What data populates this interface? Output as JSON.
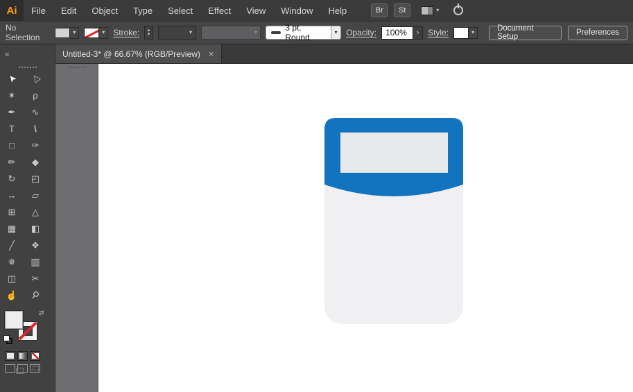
{
  "app": {
    "logo": "Ai"
  },
  "menubar": {
    "items": [
      "File",
      "Edit",
      "Object",
      "Type",
      "Select",
      "Effect",
      "View",
      "Window",
      "Help"
    ],
    "bridge_button": "Br",
    "stock_button": "St"
  },
  "controlbar": {
    "selection_status": "No Selection",
    "stroke_label": "Stroke:",
    "brush_name": "3 pt. Round",
    "opacity_label": "Opacity:",
    "opacity_value": "100%",
    "style_label": "Style:",
    "document_setup_button": "Document Setup",
    "preferences_button": "Preferences"
  },
  "tabbar": {
    "title": "Untitled-3* @ 66.67% (RGB/Preview)",
    "close": "×"
  },
  "toolbar": {
    "collapse": "«",
    "tools": [
      {
        "name": "selection",
        "glyph": "➤",
        "active": true
      },
      {
        "name": "direct-selection",
        "glyph": "▷"
      },
      {
        "name": "magic-wand",
        "glyph": "✶"
      },
      {
        "name": "lasso",
        "glyph": "ρ"
      },
      {
        "name": "pen",
        "glyph": "✒"
      },
      {
        "name": "curvature",
        "glyph": "∿"
      },
      {
        "name": "type",
        "glyph": "T"
      },
      {
        "name": "line",
        "glyph": "\\"
      },
      {
        "name": "rectangle",
        "glyph": "□"
      },
      {
        "name": "paintbrush",
        "glyph": "✑"
      },
      {
        "name": "pencil",
        "glyph": "✏"
      },
      {
        "name": "eraser",
        "glyph": "◆"
      },
      {
        "name": "rotate",
        "glyph": "↻"
      },
      {
        "name": "scale",
        "glyph": "◰"
      },
      {
        "name": "width",
        "glyph": "↔"
      },
      {
        "name": "free-transform",
        "glyph": "▱"
      },
      {
        "name": "shape-builder",
        "glyph": "⊞"
      },
      {
        "name": "perspective-grid",
        "glyph": "△"
      },
      {
        "name": "mesh",
        "glyph": "▦"
      },
      {
        "name": "gradient",
        "glyph": "◧"
      },
      {
        "name": "eyedropper",
        "glyph": "╱"
      },
      {
        "name": "blend",
        "glyph": "❖"
      },
      {
        "name": "symbol-sprayer",
        "glyph": "✵"
      },
      {
        "name": "column-graph",
        "glyph": "▥"
      },
      {
        "name": "artboard",
        "glyph": "◫"
      },
      {
        "name": "slice",
        "glyph": "✂"
      },
      {
        "name": "hand",
        "glyph": "☝"
      },
      {
        "name": "zoom",
        "glyph": "⚲"
      }
    ]
  },
  "icons": {
    "chevron": "▾",
    "swap": "⇄",
    "stepper_up": "▲",
    "stepper_down": "▼",
    "opacity_arrow": "›",
    "workspace_chevron": "▾"
  },
  "canvas": {
    "artwork": {
      "name": "jar icon with blue lid",
      "lid_color": "#1274BE",
      "body_color": "#F0F0F2",
      "screen_color": "#E8E9EB"
    }
  },
  "colors": {
    "accent_orange": "#FF9A00",
    "artwork_blue": "#1274BE",
    "chrome_dark": "#3B3B3B",
    "chrome_mid": "#454545",
    "dock_gray": "#6E6E71",
    "none_red": "#D9252B"
  }
}
